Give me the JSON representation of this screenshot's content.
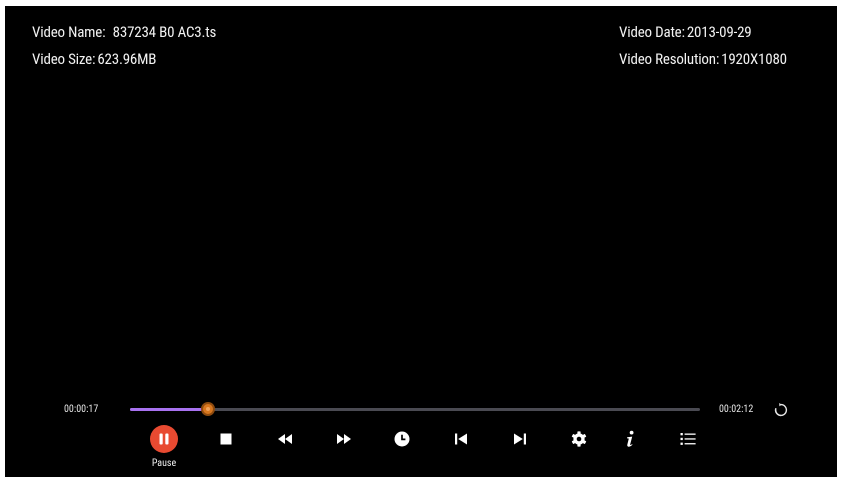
{
  "video_info": {
    "name_label": "Video Name:",
    "name_value": "837234",
    "name_suffix": "B0 AC3.ts",
    "size_label": "Video Size:",
    "size_value": "623.96MB",
    "date_label": "Video Date:",
    "date_value": "2013-09-29",
    "resolution_label": "Video Resolution:",
    "resolution_value": "1920X1080"
  },
  "playback": {
    "current_time": "00:00:17",
    "total_time": "00:02:12",
    "progress_fraction": 0.137,
    "accent_color": "#a872f0",
    "thumb_color": "#d7761e"
  },
  "controls": [
    {
      "name": "pause-button",
      "icon": "pause-icon"
    },
    {
      "name": "stop-button",
      "icon": "stop-icon"
    },
    {
      "name": "rewind-button",
      "icon": "rewind-icon"
    },
    {
      "name": "fast-forward-button",
      "icon": "fast-forward-icon"
    },
    {
      "name": "timer-button",
      "icon": "clock-icon"
    },
    {
      "name": "previous-button",
      "icon": "skip-previous-icon"
    },
    {
      "name": "next-button",
      "icon": "skip-next-icon"
    },
    {
      "name": "settings-button",
      "icon": "gear-icon"
    },
    {
      "name": "info-button",
      "icon": "info-icon"
    },
    {
      "name": "playlist-button",
      "icon": "list-icon"
    }
  ],
  "pause_label": "Pause",
  "pause_color": "#e84a31"
}
